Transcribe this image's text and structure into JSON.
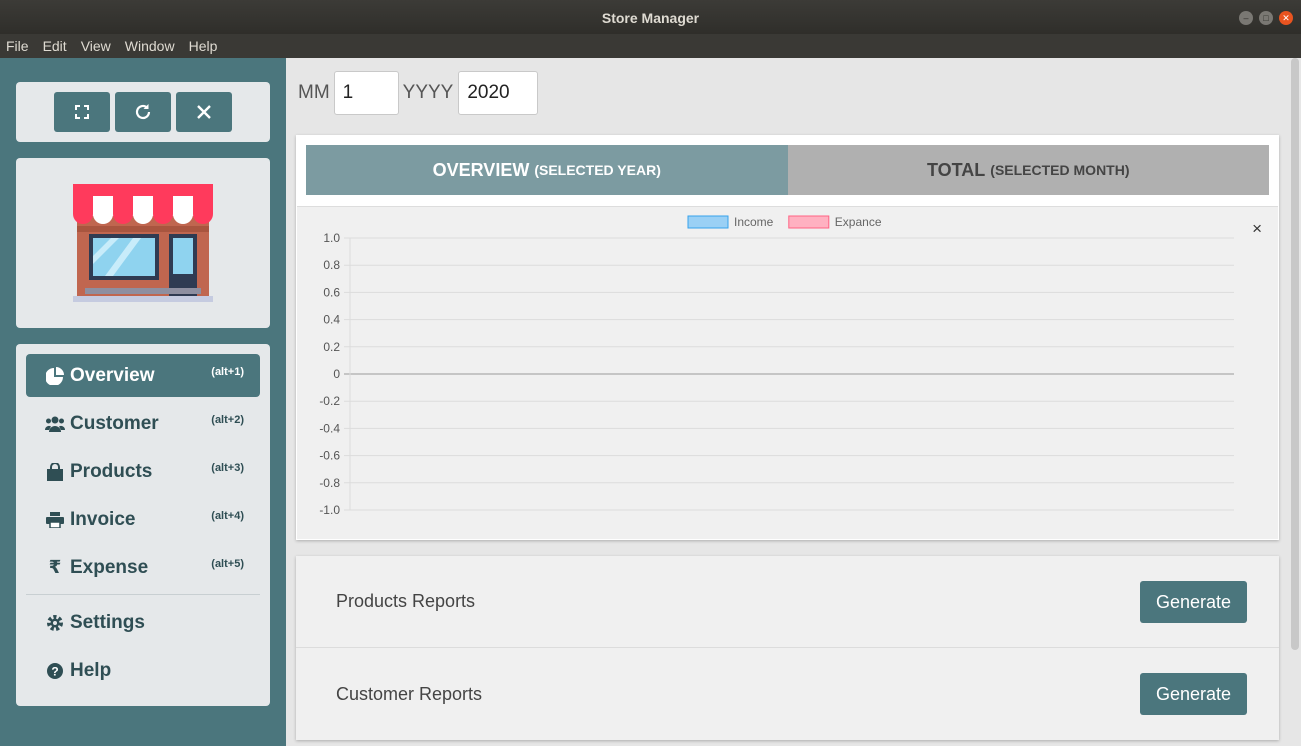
{
  "window": {
    "title": "Store Manager"
  },
  "menu": [
    "File",
    "Edit",
    "View",
    "Window",
    "Help"
  ],
  "sidebar": {
    "controls": [
      "fullscreen-icon",
      "refresh-icon",
      "close-icon"
    ],
    "nav": [
      {
        "label": "Overview",
        "shortcut": "(alt+1)",
        "icon": "pie-chart-icon",
        "active": true
      },
      {
        "label": "Customer",
        "shortcut": "(alt+2)",
        "icon": "users-icon"
      },
      {
        "label": "Products",
        "shortcut": "(alt+3)",
        "icon": "shopping-bag-icon"
      },
      {
        "label": "Invoice",
        "shortcut": "(alt+4)",
        "icon": "printer-icon"
      },
      {
        "label": "Expense",
        "shortcut": "(alt+5)",
        "icon": "rupee-icon",
        "glyph": "₹"
      }
    ],
    "footer_nav": [
      {
        "label": "Settings",
        "icon": "gear-icon"
      },
      {
        "label": "Help",
        "icon": "help-icon"
      }
    ]
  },
  "date": {
    "mm_label": "MM",
    "mm_value": "1",
    "yyyy_label": "YYYY",
    "yyyy_value": "2020"
  },
  "tabs": [
    {
      "title": "OVERVIEW",
      "sub": "(SELECTED YEAR)"
    },
    {
      "title": "TOTAL",
      "sub": "(SELECTED MONTH)"
    }
  ],
  "chart_close": "×",
  "chart_data": {
    "type": "bar",
    "categories": [],
    "series": [
      {
        "name": "Income",
        "values": [],
        "color": "#9ad0f5",
        "border": "#36a2eb"
      },
      {
        "name": "Expance",
        "values": [],
        "color": "#ffb1c1",
        "border": "#ff6384"
      }
    ],
    "ylim": [
      -1.0,
      1.0
    ],
    "yticks": [
      "1.0",
      "0.8",
      "0.6",
      "0.4",
      "0.2",
      "0",
      "-0.2",
      "-0.4",
      "-0.6",
      "-0.8",
      "-1.0"
    ],
    "legend": "top-center",
    "grid": true
  },
  "reports": [
    {
      "label": "Products Reports",
      "button": "Generate"
    },
    {
      "label": "Customer Reports",
      "button": "Generate"
    }
  ]
}
